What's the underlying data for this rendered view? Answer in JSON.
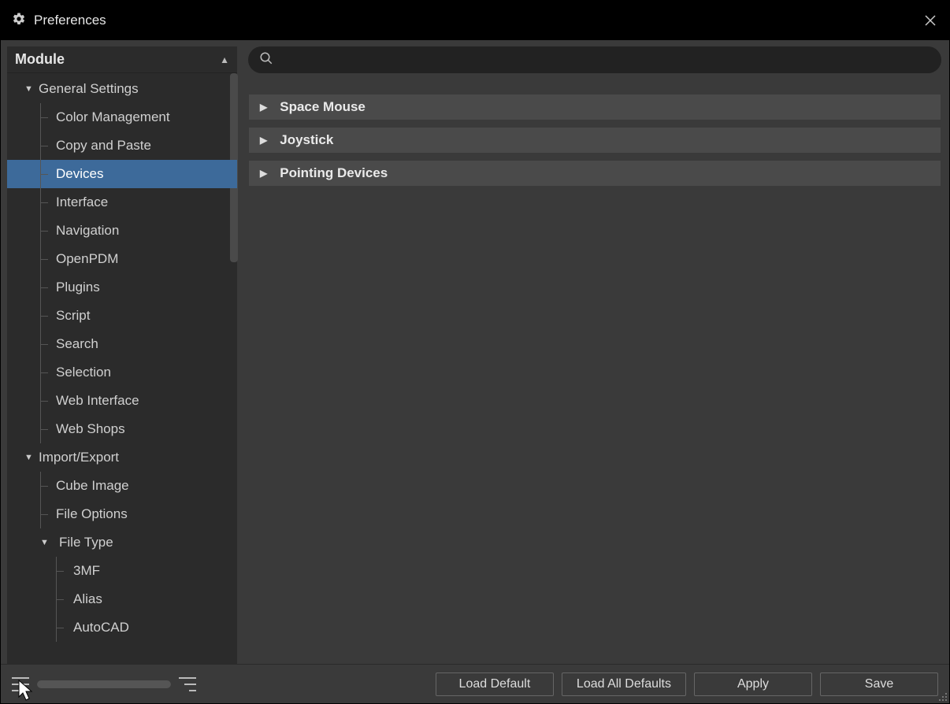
{
  "window": {
    "title": "Preferences"
  },
  "sidebar": {
    "header": "Module",
    "tree": {
      "general": {
        "label": "General Settings",
        "children": [
          "Color Management",
          "Copy and Paste",
          "Devices",
          "Interface",
          "Navigation",
          "OpenPDM",
          "Plugins",
          "Script",
          "Search",
          "Selection",
          "Web Interface",
          "Web Shops"
        ],
        "selected_index": 2
      },
      "import_export": {
        "label": "Import/Export",
        "children": [
          "Cube Image",
          "File Options"
        ],
        "file_type": {
          "label": "File Type",
          "children": [
            "3MF",
            "Alias",
            "AutoCAD"
          ]
        }
      }
    }
  },
  "main": {
    "search_placeholder": "",
    "sections": [
      "Space Mouse",
      "Joystick",
      "Pointing Devices"
    ]
  },
  "footer": {
    "load_default": "Load Default",
    "load_all_defaults": "Load All Defaults",
    "apply": "Apply",
    "save": "Save"
  }
}
